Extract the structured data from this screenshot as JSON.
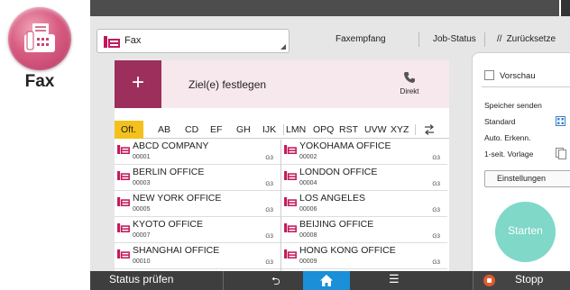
{
  "app": {
    "name": "Fax",
    "mode": "Fax"
  },
  "header": {
    "faxempfang": "Faxempfang",
    "job_status": "Job-Status",
    "zuruecksetzen": "Zurücksetze"
  },
  "destination": {
    "plus": "+",
    "ziel_label": "Ziel(e) festlegen",
    "direkt": "Direkt"
  },
  "index_tabs": [
    "Oft.",
    "AB",
    "CD",
    "EF",
    "GH",
    "IJK",
    "LMN",
    "OPQ",
    "RST",
    "UVW",
    "XYZ"
  ],
  "active_tab": "Oft.",
  "entries": [
    {
      "name": "ABCD COMPANY",
      "number": "00001",
      "line": "G3"
    },
    {
      "name": "YOKOHAMA OFFICE",
      "number": "00002",
      "line": "G3"
    },
    {
      "name": "BERLIN OFFICE",
      "number": "00003",
      "line": "G3"
    },
    {
      "name": "LONDON OFFICE",
      "number": "00004",
      "line": "G3"
    },
    {
      "name": "NEW YORK OFFICE",
      "number": "00005",
      "line": "G3"
    },
    {
      "name": "LOS ANGELES",
      "number": "00006",
      "line": "G3"
    },
    {
      "name": "KYOTO OFFICE",
      "number": "00007",
      "line": "G3"
    },
    {
      "name": "BEIJING OFFICE",
      "number": "00008",
      "line": "G3"
    },
    {
      "name": "SHANGHAI  OFFICE",
      "number": "00010",
      "line": "G3"
    },
    {
      "name": "HONG KONG OFFICE",
      "number": "00009",
      "line": "G3"
    }
  ],
  "settings": {
    "vorschau": "Vorschau",
    "speicher_senden": "Speicher senden",
    "standard": "Standard",
    "auto_erkenn": "Auto. Erkenn.",
    "vorlage": "1-seit. Vorlage",
    "einstellungen": "Einstellungen"
  },
  "start_label": "Starten",
  "bottom": {
    "status_pruefen": "Status prüfen",
    "stopp": "Stopp"
  },
  "colors": {
    "accent": "#9c2f5b",
    "index_active": "#f4c11c",
    "home": "#1b8fd8",
    "start": "#7fd8c8",
    "stop": "#e35a2b"
  }
}
